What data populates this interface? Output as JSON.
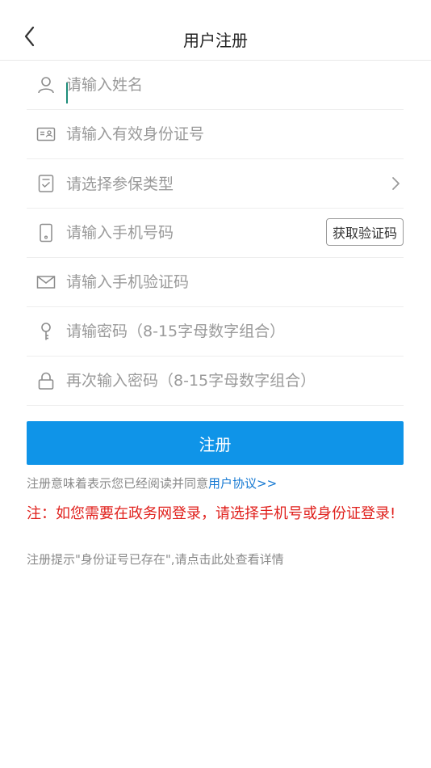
{
  "header": {
    "title": "用户注册",
    "back_icon": "chevron-left-icon"
  },
  "form": {
    "name": {
      "placeholder": "请输入姓名",
      "value": "",
      "icon": "user-icon"
    },
    "id_card": {
      "placeholder": "请输入有效身份证号",
      "value": "",
      "icon": "id-card-icon"
    },
    "insurance_type": {
      "placeholder": "请选择参保类型",
      "icon": "clipboard-check-icon",
      "chevron": "chevron-right-icon"
    },
    "phone": {
      "placeholder": "请输入手机号码",
      "value": "",
      "icon": "phone-icon",
      "code_button": "获取验证码"
    },
    "sms_code": {
      "placeholder": "请输入手机验证码",
      "value": "",
      "icon": "mail-icon"
    },
    "password": {
      "placeholder": "请输密码（8-15字母数字组合）",
      "value": "",
      "icon": "key-icon"
    },
    "password_confirm": {
      "placeholder": "再次输入密码（8-15字母数字组合）",
      "value": "",
      "icon": "lock-icon"
    }
  },
  "submit_label": "注册",
  "agreement": {
    "text": "注册意味着表示您已经阅读并同意",
    "link": "用户协议>>"
  },
  "notice": "注：如您需要在政务网登录，请选择手机号或身份证登录!",
  "hint": "注册提示\"身份证号已存在\",请点击此处查看详情",
  "colors": {
    "primary": "#0f94e8",
    "link": "#1478d2",
    "warning": "#e0201c",
    "placeholder": "#9a9a9a"
  }
}
